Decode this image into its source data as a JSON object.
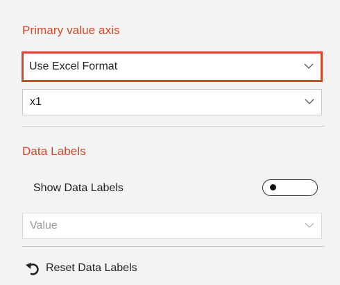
{
  "primary_value_axis": {
    "title": "Primary value axis",
    "format_select": {
      "value": "Use Excel Format",
      "highlight_color": "#d24726"
    },
    "scale_select": {
      "value": "x1"
    }
  },
  "data_labels": {
    "title": "Data Labels",
    "show_toggle": {
      "label": "Show Data Labels",
      "state": "off"
    },
    "label_select": {
      "value": "Value",
      "disabled": true
    },
    "reset": {
      "label": "Reset Data Labels",
      "icon": "undo-icon"
    }
  },
  "colors": {
    "accent": "#d24726",
    "background": "#f3f3f3"
  }
}
